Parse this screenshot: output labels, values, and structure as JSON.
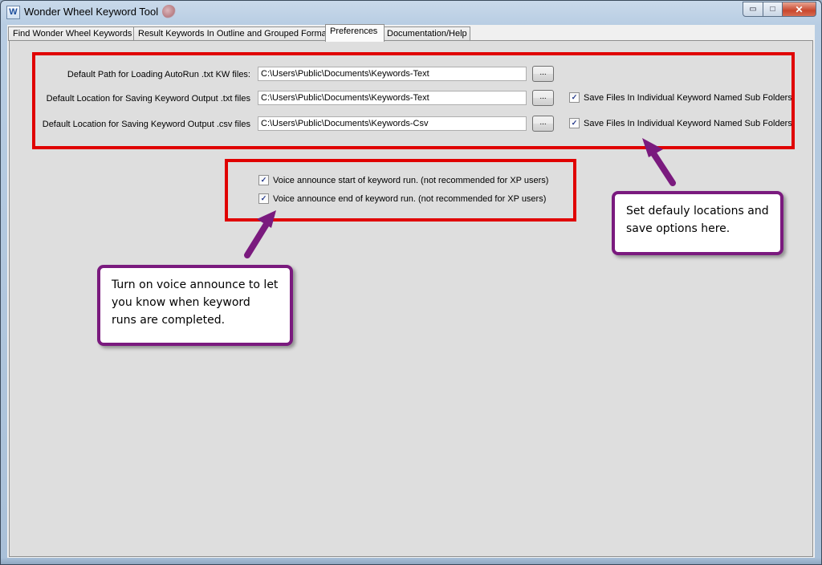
{
  "window": {
    "title": "Wonder Wheel Keyword Tool",
    "icon_letter": "W",
    "controls": {
      "minimize": "▭",
      "maximize": "□",
      "close": "✕"
    }
  },
  "tabs": [
    {
      "label": "Find Wonder Wheel Keywords",
      "active": false
    },
    {
      "label": "Result Keywords In Outline and Grouped Format",
      "active": false
    },
    {
      "label": "Preferences",
      "active": true
    },
    {
      "label": "Documentation/Help",
      "active": false
    }
  ],
  "preferences": {
    "autorun_label": "Default Path for Loading AutoRun .txt KW files:",
    "autorun_value": "C:\\Users\\Public\\Documents\\Keywords-Text",
    "txt_label": "Default Location for Saving Keyword Output .txt files",
    "txt_value": "C:\\Users\\Public\\Documents\\Keywords-Text",
    "csv_label": "Default Location for Saving Keyword Output .csv files",
    "csv_value": "C:\\Users\\Public\\Documents\\Keywords-Csv",
    "browse_label": "...",
    "subfolder_txt_label": "Save Files In Individual Keyword Named Sub Folders",
    "subfolder_csv_label": "Save Files In Individual Keyword Named Sub Folders",
    "subfolder_txt_checked": true,
    "subfolder_csv_checked": true
  },
  "voice": {
    "start_label": "Voice announce start of keyword run. (not recommended for XP users)",
    "end_label": "Voice announce end of keyword run. (not recommended for XP users)",
    "start_checked": true,
    "end_checked": true
  },
  "annotations": {
    "callout_locations": "Set defauly locations and save options here.",
    "callout_voice": "Turn on voice announce to let you know when keyword runs are completed."
  },
  "colors": {
    "highlight_red": "#e00000",
    "callout_purple": "#7a1a7e"
  },
  "check_glyph": "✓"
}
